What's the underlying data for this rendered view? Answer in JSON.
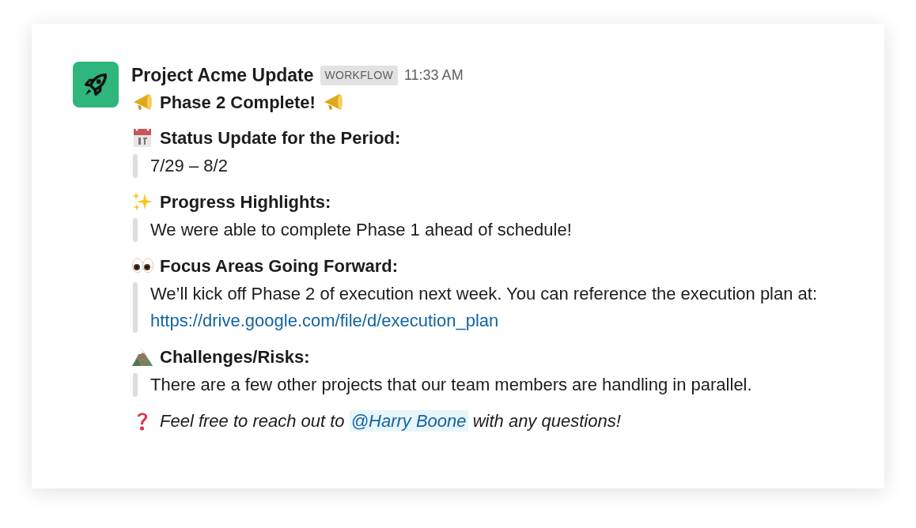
{
  "message": {
    "sender": "Project Acme Update",
    "badge": "WORKFLOW",
    "time": "11:33 AM"
  },
  "title": "Phase 2 Complete!",
  "sections": [
    {
      "kind": "calendar",
      "heading": "Status Update for the Period:",
      "body": "7/29 – 8/2"
    },
    {
      "kind": "sparkles",
      "heading": "Progress Highlights:",
      "body": "We were able to complete Phase 1 ahead of schedule!"
    },
    {
      "kind": "eyes",
      "heading": "Focus Areas Going Forward:",
      "body": "We’ll kick off Phase 2 of execution next week. You can reference the execution plan at:",
      "link": "https://drive.google.com/file/d/execution_plan"
    },
    {
      "kind": "mountain",
      "heading": "Challenges/Risks:",
      "body": "There are a few other projects that our team members are handling in parallel."
    }
  ],
  "footer": {
    "before": "Feel free to reach out to",
    "mention": "@Harry Boone",
    "after": "with any questions!"
  }
}
